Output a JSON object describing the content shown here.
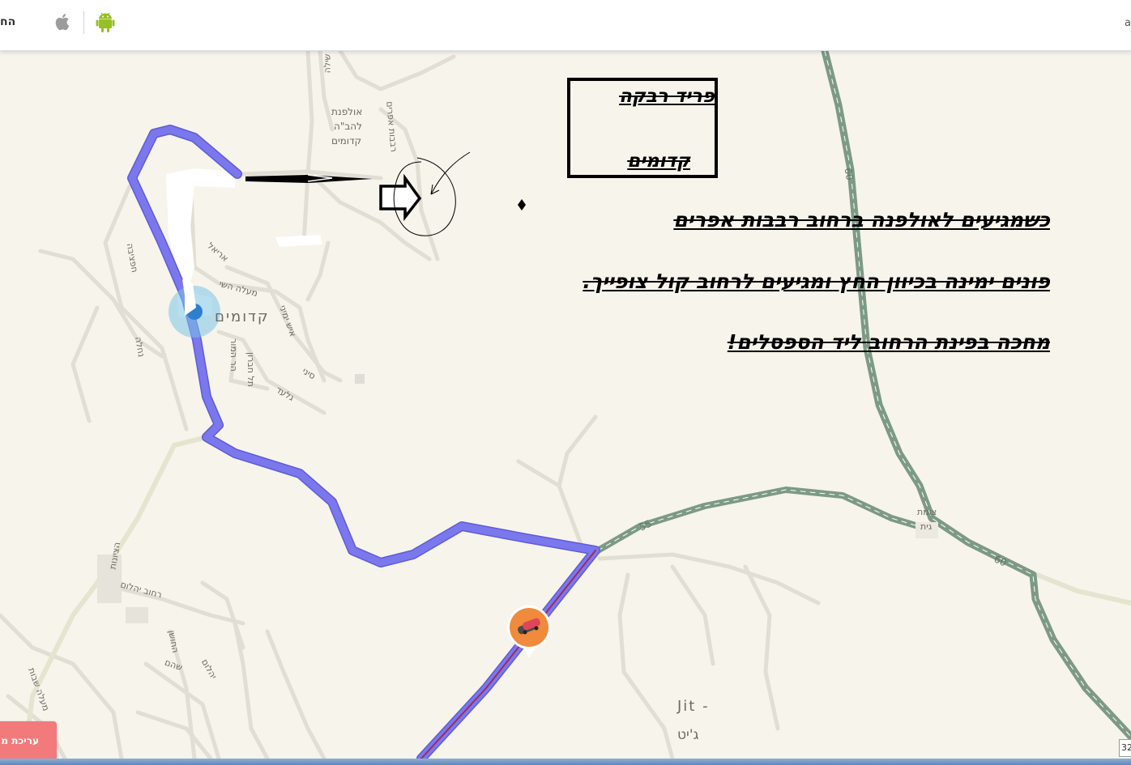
{
  "header": {
    "left_text": "הח",
    "right_text": "a",
    "icons": [
      "apple-icon",
      "android-icon"
    ]
  },
  "destination_box": {
    "line1": "פריד רבקה",
    "line2": "קדומים"
  },
  "instructions": [
    "כשמגיעים לאולפנה ברחוב רבבות אפרים",
    "פונים ימינה בכיוון החץ ומגיעים לרחוב קול צופייך.",
    "מחכה בפינת הרחוב ליד הספסלים!"
  ],
  "map_labels": {
    "town": "קדומים",
    "ulpana_l1": "אולפנת",
    "ulpana_l2": "להב\"ה",
    "ulpana_l3": "קדומים",
    "shilo": "שילה",
    "hatzeira": "חפציבה",
    "ariel": "אריאל",
    "maale_hashiva": "מעלה השי",
    "ish_yemini": "איש ימיני",
    "har_hamor": "הר המור",
    "tel_hevron": "תל חברון",
    "sinai": "סיני",
    "gilad": "גלעד",
    "nahala": "נחלה",
    "hatzionut": "הציונות",
    "rehov_yehalom": "רחוב יהלום",
    "hoshen": "החושן",
    "shoham": "שהם",
    "yahalom": "יהלום",
    "maale_shvut": "מעלה שבות",
    "junction_l1": "צומת",
    "junction_l2": "גית",
    "jit_en": "Jit -",
    "jit_he": "ג'יט",
    "route_60_a": "60",
    "route_60_b": "60",
    "route_55": "55",
    "ulpana_street": "רבבות אפרים"
  },
  "edit_button": {
    "label": "עריכת מ"
  },
  "scale_text": "32",
  "colors": {
    "route": "#7b78ee",
    "highway": "#7d9a84",
    "traffic_pin": "#f08a3c",
    "background": "#f7f4ec"
  }
}
